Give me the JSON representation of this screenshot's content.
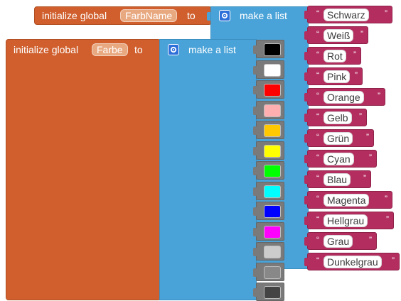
{
  "block1": {
    "init_label": "initialize global",
    "var_name": "FarbName",
    "to_label": "to",
    "list_label": "make a list",
    "strings": [
      "Schwarz",
      "Weiß",
      "Rot",
      "Pink",
      "Orange",
      "Gelb",
      "Grün",
      "Cyan",
      "Blau",
      "Magenta",
      "Hellgrau",
      "Grau",
      "Dunkelgrau"
    ]
  },
  "block2": {
    "init_label": "initialize global",
    "var_name": "Farbe",
    "to_label": "to",
    "list_label": "make a list",
    "colors": [
      "#000000",
      "#ffffff",
      "#ff0000",
      "#ffafaf",
      "#ffc800",
      "#ffff00",
      "#00ff00",
      "#00ffff",
      "#0000ff",
      "#ff00ff",
      "#cccccc",
      "#888888",
      "#444444"
    ]
  },
  "quote_open": "“",
  "quote_close": "”",
  "icons": {
    "mutator": "gear-icon"
  },
  "theme": {
    "variable_block": "#d05f2d",
    "list_block": "#4aa3d8",
    "text_block": "#b32d5e",
    "color_block": "#7a7a7a"
  }
}
